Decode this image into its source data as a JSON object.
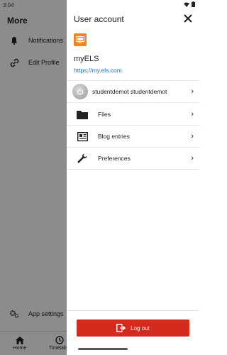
{
  "status": {
    "time": "3:04"
  },
  "background": {
    "title": "More",
    "items": [
      {
        "label": "Notifications",
        "icon": "bell-icon"
      },
      {
        "label": "Edit Profile",
        "icon": "link-icon"
      }
    ],
    "app_settings": "App settings",
    "tabs": [
      {
        "label": "Home",
        "icon": "home-icon"
      },
      {
        "label": "Timetable",
        "icon": "clock-icon"
      }
    ]
  },
  "drawer": {
    "title": "User account",
    "site_name": "myELS",
    "site_url": "https://my.els.com",
    "user_name": "studentdemot studentdemot",
    "menu": [
      {
        "label": "Files",
        "icon": "folder-icon"
      },
      {
        "label": "Blog entries",
        "icon": "blog-icon"
      },
      {
        "label": "Preferences",
        "icon": "wrench-icon"
      }
    ],
    "logout_label": "Log out",
    "accent": "#d42b1e",
    "link_color": "#1b6bc6"
  }
}
